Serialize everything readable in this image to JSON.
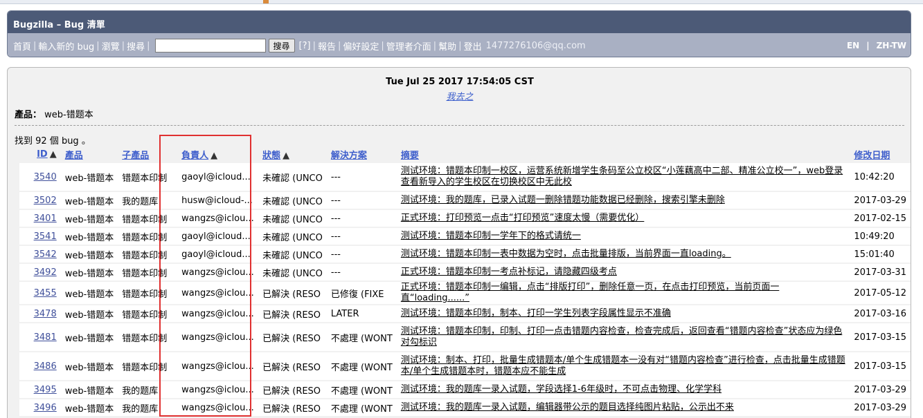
{
  "header": {
    "title": "Bugzilla – Bug 清單",
    "nav": [
      "首頁",
      "輸入新的 bug",
      "瀏覽",
      "搜尋"
    ],
    "search_value": "",
    "search_button": "搜尋",
    "help": "[?]",
    "nav2": [
      "報告",
      "偏好設定",
      "管理者介面",
      "幫助",
      "登出"
    ],
    "user": "1477276106@qq.com",
    "langs": [
      "EN",
      "ZH-TW"
    ]
  },
  "page": {
    "date": "Tue Jul 25 2017 17:54:05 CST",
    "saved_search": "我去之",
    "product_label": "產品：",
    "product_value": "web-错题本",
    "found_text": "找到 92 個 bug 。"
  },
  "table": {
    "columns": [
      {
        "label": "ID",
        "arrow": "▲",
        "link": true
      },
      {
        "label": "產品",
        "arrow": "",
        "link": true
      },
      {
        "label": "子產品",
        "arrow": "",
        "link": true
      },
      {
        "label": "負責人",
        "arrow": "▲",
        "link": true
      },
      {
        "label": "狀態",
        "arrow": "▲",
        "link": true
      },
      {
        "label": "解決方案",
        "arrow": "",
        "link": true
      },
      {
        "label": "摘要",
        "arrow": "",
        "link": true
      },
      {
        "label": "修改日期",
        "arrow": "",
        "link": true
      }
    ],
    "rows": [
      {
        "id": "3540",
        "product": "web-错题本",
        "component": "错题本印制",
        "assignee": "gaoyl@icloud...",
        "status": "未確認 (UNCO",
        "resolution": "---",
        "summary": "测试环境：错题本印制一校区，运营系统新增学生条码至公立校区“小莲藕高中二部、精准公立校一”，web登录查看新导入的学生校区在切换校区中无此校",
        "changed": "10:42:20"
      },
      {
        "id": "3502",
        "product": "web-错题本",
        "component": "我的题库",
        "assignee": "husw@icloud-...",
        "status": "未確認 (UNCO",
        "resolution": "---",
        "summary": "测试环境：我的题库，已录入试题一删除错题功能数据已经删除，搜索引擎未删除",
        "changed": "2017-03-29"
      },
      {
        "id": "3401",
        "product": "web-错题本",
        "component": "错题本印制",
        "assignee": "wangzs@iclou...",
        "status": "未確認 (UNCO",
        "resolution": "---",
        "summary": "正式环境：打印预览一点击“打印预览”速度太慢（需要优化）",
        "changed": "2017-02-15"
      },
      {
        "id": "3541",
        "product": "web-错题本",
        "component": "错题本印制",
        "assignee": "gaoyl@icloud...",
        "status": "未確認 (UNCO",
        "resolution": "---",
        "summary": "测试环境：错题本印制一学年下的格式请统一",
        "changed": "10:49:20"
      },
      {
        "id": "3542",
        "product": "web-错题本",
        "component": "错题本印制",
        "assignee": "gaoyl@icloud...",
        "status": "未確認 (UNCO",
        "resolution": "---",
        "summary": "测试环境：错题本印制一表中数据为空时，点击批量排版，当前界面一直loading。",
        "changed": "15:01:40"
      },
      {
        "id": "3492",
        "product": "web-错题本",
        "component": "错题本印制",
        "assignee": "wangzs@iclou...",
        "status": "未確認 (UNCO",
        "resolution": "---",
        "summary": "正式环境：错题本印制一考点补标记，请隐藏四级考点",
        "changed": "2017-03-31"
      },
      {
        "id": "3455",
        "product": "web-错题本",
        "component": "错题本印制",
        "assignee": "wangzs@iclou...",
        "status": "已解決 (RESO",
        "resolution": "已修復 (FIXE",
        "summary": "正式环境：错题本印制一编辑，点击“排版打印”，删除任意一页，在点击打印预览，当前页面一直“loading......”",
        "changed": "2017-05-12"
      },
      {
        "id": "3478",
        "product": "web-错题本",
        "component": "错题本印制",
        "assignee": "wangzs@iclou...",
        "status": "已解決 (RESO",
        "resolution": "LATER",
        "summary": "测试环境：错题本印制，制本、打印一学生列表字段属性显示不准确",
        "changed": "2017-03-16"
      },
      {
        "id": "3481",
        "product": "web-错题本",
        "component": "错题本印制",
        "assignee": "wangzs@iclou...",
        "status": "已解決 (RESO",
        "resolution": "不處理 (WONT",
        "summary": "测试环境：错题本印制，印制、打印一点击错题内容检查，检查完成后，返回查看“错题内容检查”状态应为绿色对勾标识",
        "changed": "2017-03-15"
      },
      {
        "id": "3486",
        "product": "web-错题本",
        "component": "错题本印制",
        "assignee": "wangzs@iclou...",
        "status": "已解決 (RESO",
        "resolution": "不處理 (WONT",
        "summary": "测试环境：制本、打印，批量生成错题本/单个生成错题本一没有对“错题内容检查”进行检查，点击批量生成错题本/单个生成错题本时，错题本应不能生成",
        "changed": "2017-03-15"
      },
      {
        "id": "3495",
        "product": "web-错题本",
        "component": "我的题库",
        "assignee": "wangzs@iclou...",
        "status": "已解決 (RESO",
        "resolution": "不處理 (WONT",
        "summary": "测试环境：我的题库一录入试题，学段选择1-6年级时，不可点击物理、化学学科",
        "changed": "2017-03-29"
      },
      {
        "id": "3496",
        "product": "web-错题本",
        "component": "我的题库",
        "assignee": "wangzs@iclou...",
        "status": "已解決 (RESO",
        "resolution": "不處理 (WONT",
        "summary": "测试环境：我的题库一录入试题，编辑器带公示的题目选择纯图片粘贴，公示出不来",
        "changed": "2017-03-29"
      }
    ]
  },
  "colors": {
    "title_bar": "#4c5a77",
    "nav_bar": "#a9b0c3",
    "link": "#3f5fcc",
    "highlight": "#e03030"
  }
}
